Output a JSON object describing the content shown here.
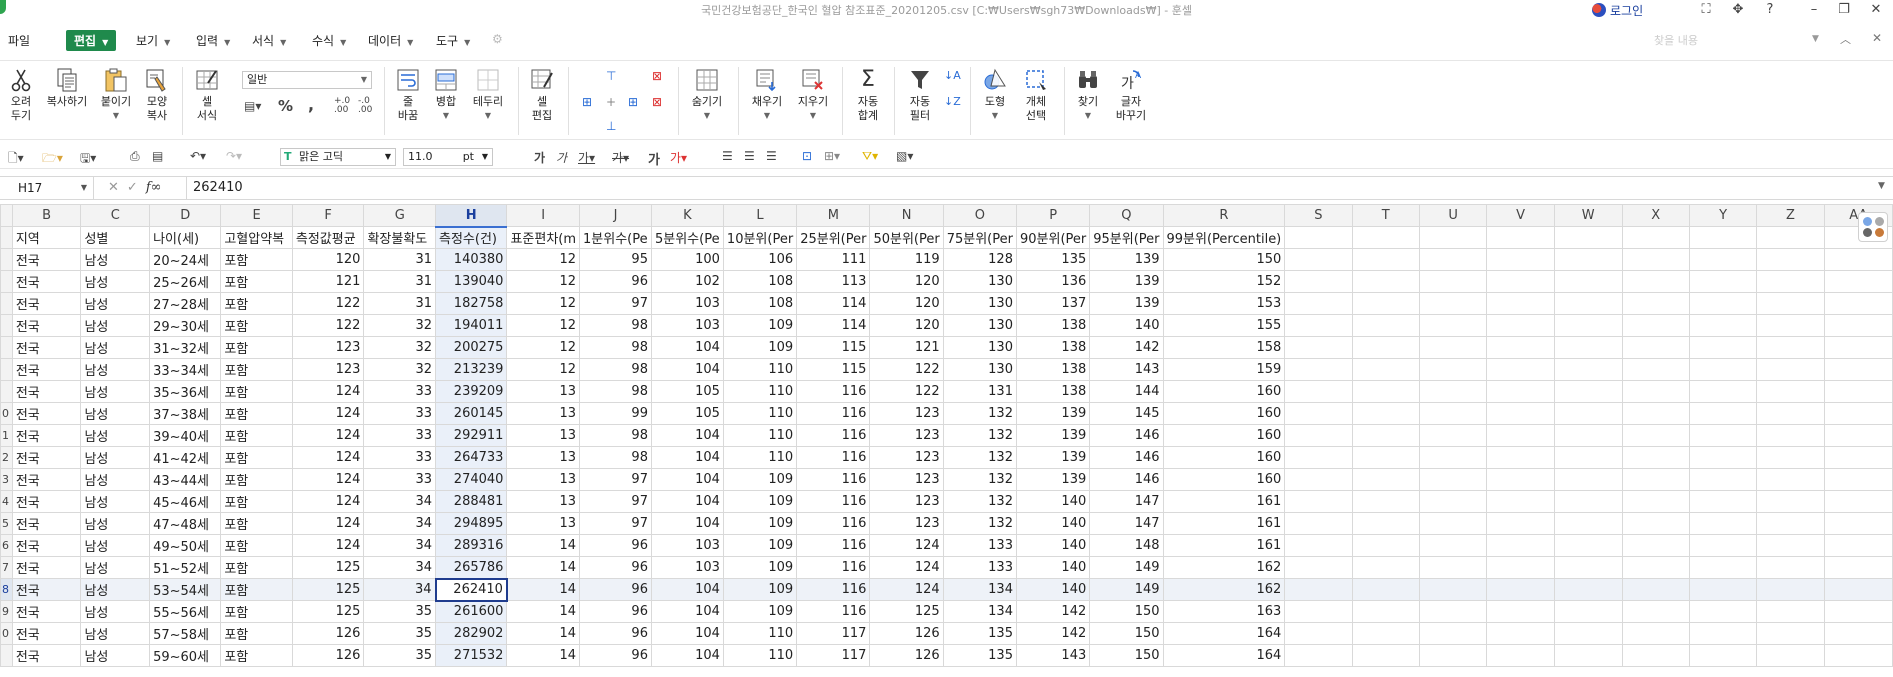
{
  "titlebar": {
    "title": "국민건강보험공단_한국인 혈압 참조표준_20201205.csv [C:₩Users₩sgh73₩Downloads₩] - 훈셀",
    "login": "로그인"
  },
  "menu": {
    "file": "파일",
    "edit": "편집",
    "view": "보기",
    "insert": "입력",
    "format": "서식",
    "formula": "수식",
    "data": "데이터",
    "tools": "도구",
    "search_placeholder": "찾을 내용"
  },
  "ribbon": {
    "cut": [
      "오려",
      "두기"
    ],
    "copy": "복사하기",
    "paste": "붙이기",
    "format_copy": [
      "모양",
      "복사"
    ],
    "cell_style": [
      "셀",
      "서식"
    ],
    "number_format": "일반",
    "line_wrap": [
      "줄",
      "바꿈"
    ],
    "merge": "병합",
    "border": "테두리",
    "cell_edit": [
      "셀",
      "편집"
    ],
    "hide": "숨기기",
    "fill": "채우기",
    "erase": "지우기",
    "autosum": [
      "자동",
      "합계"
    ],
    "autofilter": [
      "자동",
      "필터"
    ],
    "shape": "도형",
    "select_obj": [
      "개체",
      "선택"
    ],
    "find": "찾기",
    "replace": [
      "글자",
      "바꾸기"
    ]
  },
  "toolbar2": {
    "font": "맑은 고딕",
    "size": "11.0",
    "unit": "pt"
  },
  "formula_bar": {
    "cell_ref": "H17",
    "value": "262410"
  },
  "columns": [
    "B",
    "C",
    "D",
    "E",
    "F",
    "G",
    "H",
    "I",
    "J",
    "K",
    "L",
    "M",
    "N",
    "O",
    "P",
    "Q",
    "R",
    "S",
    "T",
    "U",
    "V",
    "W",
    "X",
    "Y",
    "Z",
    "AA"
  ],
  "selected_column": "H",
  "header_row": [
    "지역",
    "성별",
    "나이(세)",
    "고혈압약복",
    "측정값평균",
    "확장불확도",
    "측정수(건)",
    "표준편차(m",
    "1분위수(Pe",
    "5분위수(Pe",
    "10분위(Per",
    "25분위(Per",
    "50분위(Per",
    "75분위(Per",
    "90분위(Per",
    "95분위(Per",
    "99분위(Percentile)"
  ],
  "row_labels": [
    "",
    "",
    "",
    "",
    "",
    "",
    "",
    "",
    "0",
    "1",
    "2",
    "3",
    "4",
    "5",
    "6",
    "7",
    "8",
    "9",
    "0",
    ""
  ],
  "selected_row_index": 15,
  "rows": [
    [
      "전국",
      "남성",
      "20~24세",
      "포함",
      "120",
      "31",
      "140380",
      "12",
      "95",
      "100",
      "106",
      "111",
      "119",
      "128",
      "135",
      "139",
      "150"
    ],
    [
      "전국",
      "남성",
      "25~26세",
      "포함",
      "121",
      "31",
      "139040",
      "12",
      "96",
      "102",
      "108",
      "113",
      "120",
      "130",
      "136",
      "139",
      "152"
    ],
    [
      "전국",
      "남성",
      "27~28세",
      "포함",
      "122",
      "31",
      "182758",
      "12",
      "97",
      "103",
      "108",
      "114",
      "120",
      "130",
      "137",
      "139",
      "153"
    ],
    [
      "전국",
      "남성",
      "29~30세",
      "포함",
      "122",
      "32",
      "194011",
      "12",
      "98",
      "103",
      "109",
      "114",
      "120",
      "130",
      "138",
      "140",
      "155"
    ],
    [
      "전국",
      "남성",
      "31~32세",
      "포함",
      "123",
      "32",
      "200275",
      "12",
      "98",
      "104",
      "109",
      "115",
      "121",
      "130",
      "138",
      "142",
      "158"
    ],
    [
      "전국",
      "남성",
      "33~34세",
      "포함",
      "123",
      "32",
      "213239",
      "12",
      "98",
      "104",
      "110",
      "115",
      "122",
      "130",
      "138",
      "143",
      "159"
    ],
    [
      "전국",
      "남성",
      "35~36세",
      "포함",
      "124",
      "33",
      "239209",
      "13",
      "98",
      "105",
      "110",
      "116",
      "122",
      "131",
      "138",
      "144",
      "160"
    ],
    [
      "전국",
      "남성",
      "37~38세",
      "포함",
      "124",
      "33",
      "260145",
      "13",
      "99",
      "105",
      "110",
      "116",
      "123",
      "132",
      "139",
      "145",
      "160"
    ],
    [
      "전국",
      "남성",
      "39~40세",
      "포함",
      "124",
      "33",
      "292911",
      "13",
      "98",
      "104",
      "110",
      "116",
      "123",
      "132",
      "139",
      "146",
      "160"
    ],
    [
      "전국",
      "남성",
      "41~42세",
      "포함",
      "124",
      "33",
      "264733",
      "13",
      "98",
      "104",
      "110",
      "116",
      "123",
      "132",
      "139",
      "146",
      "160"
    ],
    [
      "전국",
      "남성",
      "43~44세",
      "포함",
      "124",
      "33",
      "274040",
      "13",
      "97",
      "104",
      "109",
      "116",
      "123",
      "132",
      "139",
      "146",
      "160"
    ],
    [
      "전국",
      "남성",
      "45~46세",
      "포함",
      "124",
      "34",
      "288481",
      "13",
      "97",
      "104",
      "109",
      "116",
      "123",
      "132",
      "140",
      "147",
      "161"
    ],
    [
      "전국",
      "남성",
      "47~48세",
      "포함",
      "124",
      "34",
      "294895",
      "13",
      "97",
      "104",
      "109",
      "116",
      "123",
      "132",
      "140",
      "147",
      "161"
    ],
    [
      "전국",
      "남성",
      "49~50세",
      "포함",
      "124",
      "34",
      "289316",
      "14",
      "96",
      "103",
      "109",
      "116",
      "124",
      "133",
      "140",
      "148",
      "161"
    ],
    [
      "전국",
      "남성",
      "51~52세",
      "포함",
      "125",
      "34",
      "265786",
      "14",
      "96",
      "103",
      "109",
      "116",
      "124",
      "133",
      "140",
      "149",
      "162"
    ],
    [
      "전국",
      "남성",
      "53~54세",
      "포함",
      "125",
      "34",
      "262410",
      "14",
      "96",
      "104",
      "109",
      "116",
      "124",
      "134",
      "140",
      "149",
      "162"
    ],
    [
      "전국",
      "남성",
      "55~56세",
      "포함",
      "125",
      "35",
      "261600",
      "14",
      "96",
      "104",
      "109",
      "116",
      "125",
      "134",
      "142",
      "150",
      "163"
    ],
    [
      "전국",
      "남성",
      "57~58세",
      "포함",
      "126",
      "35",
      "282902",
      "14",
      "96",
      "104",
      "110",
      "117",
      "126",
      "135",
      "142",
      "150",
      "164"
    ],
    [
      "전국",
      "남성",
      "59~60세",
      "포함",
      "126",
      "35",
      "271532",
      "14",
      "96",
      "104",
      "110",
      "117",
      "126",
      "135",
      "143",
      "150",
      "164"
    ]
  ]
}
